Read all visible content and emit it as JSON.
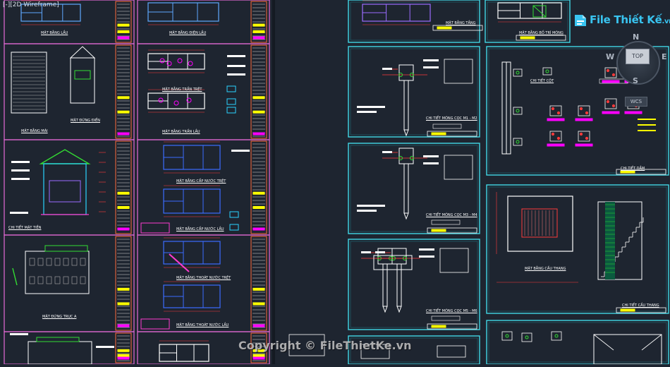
{
  "viewport": {
    "label": "[-][2D Wireframe]"
  },
  "logo": {
    "text": "File Thiết Kế",
    "tld": ".vn",
    "color": "#39c4f0"
  },
  "navcube": {
    "top_label": "TOP",
    "north": "N",
    "south": "S",
    "west": "W",
    "east": "E",
    "wcs_label": "WCS"
  },
  "watermark": {
    "text": "Copyright © FileThietKe.vn"
  },
  "colors": {
    "background": "#1e2530",
    "left_frame": "#e66bd7",
    "right_frame": "#40d7e6",
    "title_bar": "#ff00ff",
    "label_bar": "#ffff00",
    "walls": "#ffffff",
    "dims": "#ff3b3b",
    "detail_green": "#33dd33",
    "detail_cyan": "#2ad4ff",
    "detail_blue": "#3b6cff"
  },
  "sheets": {
    "left": [
      {
        "title": "MẶT BẰNG LẦU"
      },
      {
        "title": "MẶT BẰNG ĐIỆN LẦU"
      },
      {
        "title": "MẶT BẰNG MÁI"
      },
      {
        "title": "MẶT ĐỨNG ĐIỀN"
      },
      {
        "title": "MẶT BẰNG TRẦN TRỆT"
      },
      {
        "title": "MẶT BẰNG TRẦN LẦU"
      },
      {
        "title": "CHI TIẾT MẶT TIỀN"
      },
      {
        "title": "MẶT BẰNG CẤP NƯỚC TRỆT"
      },
      {
        "title": "MẶT BẰNG CẤP NƯỚC LẦU"
      },
      {
        "title": "MẶT ĐỨNG TRỤC A"
      },
      {
        "title": "MẶT BẰNG THOÁT NƯỚC TRỆT"
      },
      {
        "title": "MẶT BẰNG THOÁT NƯỚC LẦU"
      }
    ],
    "right": [
      {
        "title": "MẶT BẰNG TẦNG"
      },
      {
        "title": "MẶT BẰNG BỐ TRÍ MÓNG"
      },
      {
        "title": "CHI TIẾT MÓNG CỌC M1 - M2"
      },
      {
        "title": "CHI TIẾT MÓNG CỌC M3 - M4"
      },
      {
        "title": "CHI TIẾT MÓNG CỌC M5 - M6"
      },
      {
        "title": "CHI TIẾT CỘT"
      },
      {
        "title": "CHI TIẾT DẦM"
      },
      {
        "title": "MẶT BẰNG CẦU THANG"
      },
      {
        "title": "CHI TIẾT CẦU THANG"
      }
    ]
  }
}
